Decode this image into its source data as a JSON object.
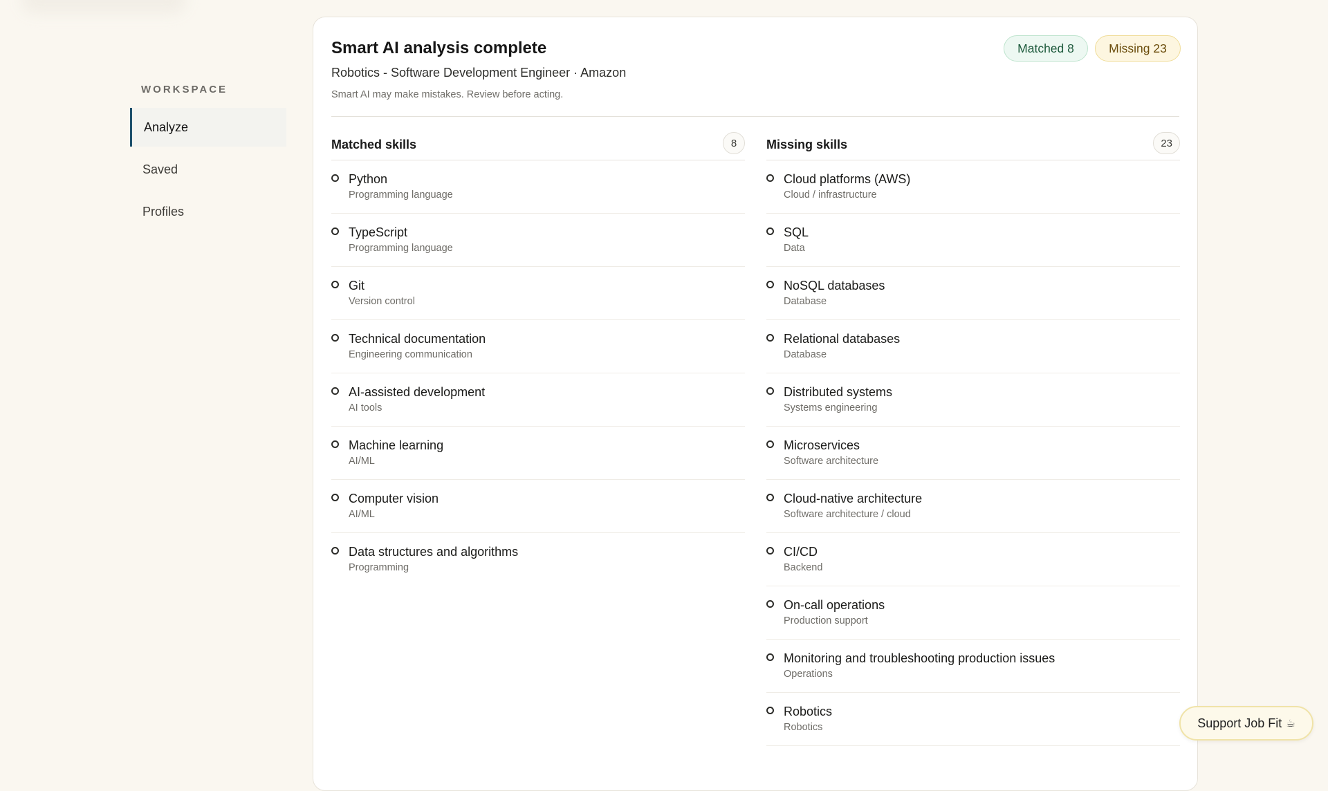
{
  "sidebar": {
    "section_label": "WORKSPACE",
    "items": [
      {
        "label": "Analyze",
        "active": true
      },
      {
        "label": "Saved",
        "active": false
      },
      {
        "label": "Profiles",
        "active": false
      }
    ]
  },
  "card": {
    "title": "Smart AI analysis complete",
    "subtitle": "Robotics - Software Development Engineer · Amazon",
    "note": "Smart AI may make mistakes. Review before acting.",
    "badges": {
      "matched": "Matched 8",
      "missing": "Missing 23"
    }
  },
  "matched": {
    "title": "Matched skills",
    "count": "8",
    "items": [
      {
        "name": "Python",
        "category": "Programming language"
      },
      {
        "name": "TypeScript",
        "category": "Programming language"
      },
      {
        "name": "Git",
        "category": "Version control"
      },
      {
        "name": "Technical documentation",
        "category": "Engineering communication"
      },
      {
        "name": "AI-assisted development",
        "category": "AI tools"
      },
      {
        "name": "Machine learning",
        "category": "AI/ML"
      },
      {
        "name": "Computer vision",
        "category": "AI/ML"
      },
      {
        "name": "Data structures and algorithms",
        "category": "Programming"
      }
    ]
  },
  "missing": {
    "title": "Missing skills",
    "count": "23",
    "items": [
      {
        "name": "Cloud platforms (AWS)",
        "category": "Cloud / infrastructure"
      },
      {
        "name": "SQL",
        "category": "Data"
      },
      {
        "name": "NoSQL databases",
        "category": "Database"
      },
      {
        "name": "Relational databases",
        "category": "Database"
      },
      {
        "name": "Distributed systems",
        "category": "Systems engineering"
      },
      {
        "name": "Microservices",
        "category": "Software architecture"
      },
      {
        "name": "Cloud-native architecture",
        "category": "Software architecture / cloud"
      },
      {
        "name": "CI/CD",
        "category": "Backend"
      },
      {
        "name": "On-call operations",
        "category": "Production support"
      },
      {
        "name": "Monitoring and troubleshooting production issues",
        "category": "Operations"
      },
      {
        "name": "Robotics",
        "category": "Robotics"
      }
    ]
  },
  "support": {
    "label": "Support Job Fit",
    "icon": "coffee-icon"
  },
  "colors": {
    "accent": "#1c4f6b",
    "matched_bg": "#edf8f2",
    "missing_bg": "#fdf6e0",
    "page_bg": "#faf7f0"
  }
}
